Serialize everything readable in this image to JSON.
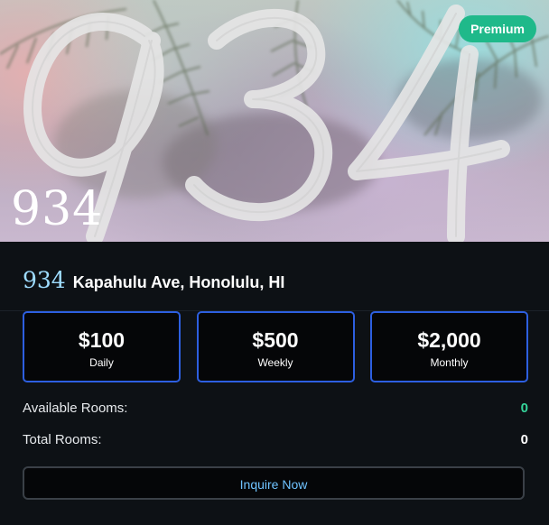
{
  "hero": {
    "big_number": "934",
    "small_number": "934",
    "badge": "Premium"
  },
  "address": {
    "number": "934",
    "text": "Kapahulu Ave, Honolulu, HI"
  },
  "prices": [
    {
      "amount": "$100",
      "period": "Daily"
    },
    {
      "amount": "$500",
      "period": "Weekly"
    },
    {
      "amount": "$2,000",
      "period": "Monthly"
    }
  ],
  "stats": {
    "available_label": "Available Rooms:",
    "available_value": "0",
    "total_label": "Total Rooms:",
    "total_value": "0"
  },
  "cta": {
    "label": "Inquire Now"
  },
  "colors": {
    "badge": "#1fb98a",
    "price_border": "#2d5fe0",
    "available_value": "#35d49a",
    "cta_text": "#6fc3ff"
  }
}
